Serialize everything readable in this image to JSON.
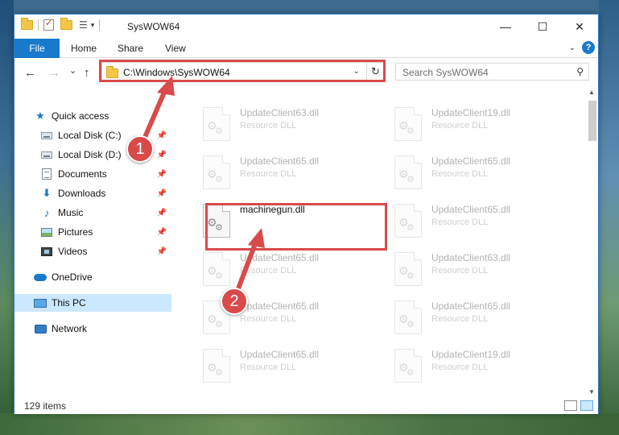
{
  "window": {
    "title": "SysWOW64",
    "controls": {
      "minimize": "—",
      "maximize": "☐",
      "close": "✕"
    }
  },
  "ribbon": {
    "tabs": [
      "File",
      "Home",
      "Share",
      "View"
    ],
    "help": "?"
  },
  "navigation": {
    "back": "←",
    "forward": "→",
    "recent": "⌄",
    "up": "↑",
    "address": "C:\\Windows\\SysWOW64",
    "refresh": "↻",
    "search_placeholder": "Search SysWOW64"
  },
  "sidebar": {
    "items": [
      {
        "label": "Quick access",
        "icon": "star-icon"
      },
      {
        "label": "Local Disk (C:)",
        "icon": "drive-icon",
        "pinned": true
      },
      {
        "label": "Local Disk (D:)",
        "icon": "drive-icon",
        "pinned": true
      },
      {
        "label": "Documents",
        "icon": "documents-icon",
        "pinned": true
      },
      {
        "label": "Downloads",
        "icon": "downloads-icon",
        "pinned": true
      },
      {
        "label": "Music",
        "icon": "music-icon",
        "pinned": true
      },
      {
        "label": "Pictures",
        "icon": "pictures-icon",
        "pinned": true
      },
      {
        "label": "Videos",
        "icon": "videos-icon",
        "pinned": true
      },
      {
        "label": "OneDrive",
        "icon": "cloud-icon"
      },
      {
        "label": "This PC",
        "icon": "computer-icon",
        "selected": true
      },
      {
        "label": "Network",
        "icon": "network-icon"
      }
    ]
  },
  "files": [
    {
      "name": "UpdateClient63.dll",
      "type": "Resource DLL",
      "faded": true
    },
    {
      "name": "UpdateClient19.dll",
      "type": "Resource DLL",
      "faded": true
    },
    {
      "name": "UpdateClient65.dll",
      "type": "Resource DLL",
      "faded": true
    },
    {
      "name": "UpdateClient65.dll",
      "type": "Resource DLL",
      "faded": true
    },
    {
      "name": "machinegun.dll",
      "type": "",
      "faded": false,
      "highlighted": true
    },
    {
      "name": "UpdateClient65.dll",
      "type": "Resource DLL",
      "faded": true
    },
    {
      "name": "UpdateClient65.dll",
      "type": "Resource DLL",
      "faded": true
    },
    {
      "name": "UpdateClient63.dll",
      "type": "Resource DLL",
      "faded": true
    },
    {
      "name": "UpdateClient65.dll",
      "type": "Resource DLL",
      "faded": true
    },
    {
      "name": "UpdateClient65.dll",
      "type": "Resource DLL",
      "faded": true
    },
    {
      "name": "UpdateClient65.dll",
      "type": "Resource DLL",
      "faded": true
    },
    {
      "name": "UpdateClient19.dll",
      "type": "Resource DLL",
      "faded": true
    }
  ],
  "status": {
    "item_count": "129 items"
  },
  "annotations": {
    "step1": "1",
    "step2": "2",
    "color": "#d94a4a"
  }
}
